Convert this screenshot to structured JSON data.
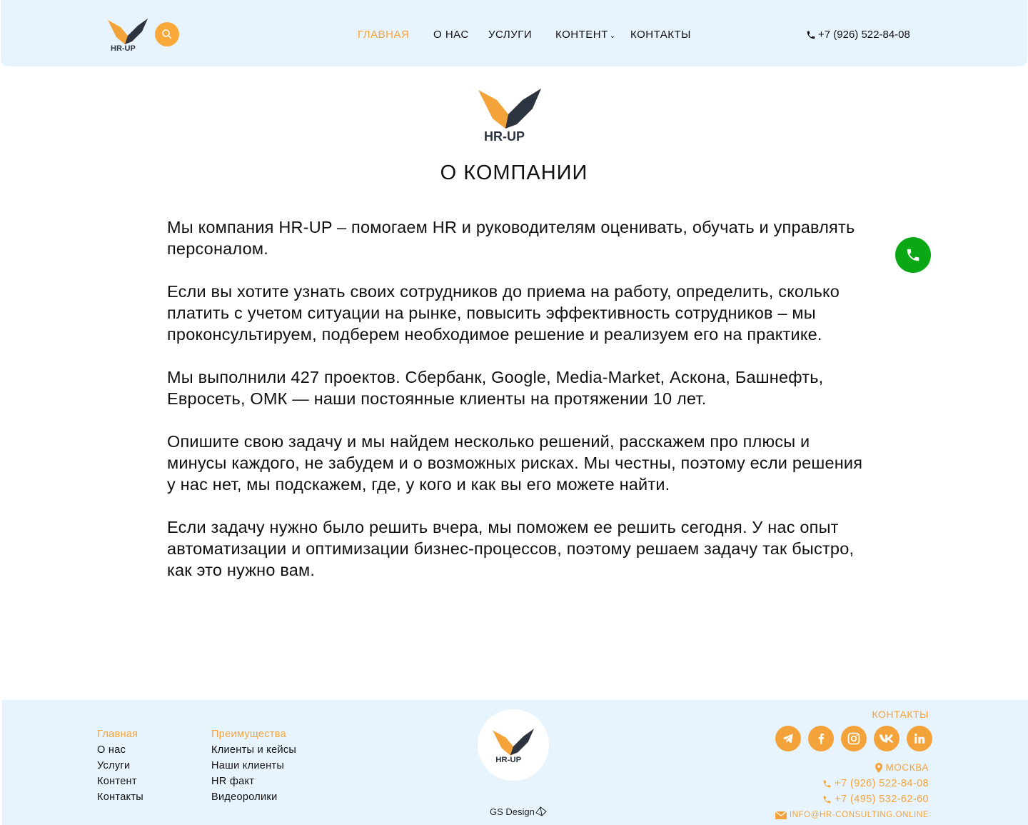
{
  "header": {
    "logo_text": "HR-UP",
    "nav": [
      {
        "label": "ГЛАВНАЯ",
        "active": true
      },
      {
        "label": "О НАС"
      },
      {
        "label": "УСЛУГИ"
      },
      {
        "label": "КОНТЕНТ"
      },
      {
        "label": "КОНТАКТЫ"
      }
    ],
    "phone": "+7 (926) 522-84-08"
  },
  "main": {
    "logo_text": "HR-UP",
    "title": "О КОМПАНИИ",
    "paragraphs": [
      "Мы компания HR-UP – помогаем HR и руководителям оценивать, обучать и управлять персоналом.",
      "Если вы хотите узнать своих сотрудников до приема на работу, определить, сколько платить с учетом ситуации на рынке, повысить эффективность сотрудников – мы проконсультируем, подберем необходимое решение и реализуем его на практике.",
      "Мы выполнили 427 проектов. Сбербанк, Google, Media-Market, Аскона, Башнефть, Евросеть, ОМК — наши постоянные клиенты на протяжении 10 лет.",
      "Опишите свою задачу и мы найдем несколько решений, расскажем про плюсы и минусы каждого, не забудем и о возможных рисках. Мы честны, поэтому если решения у нас нет, мы подскажем, где, у кого и как вы его можете найти.",
      "Если задачу нужно было решить вчера, мы поможем ее решить сегодня. У нас опыт автоматизации и оптимизации бизнес-процессов, поэтому решаем задачу так быстро, как это нужно вам."
    ]
  },
  "footer": {
    "col1": [
      "Главная",
      "О нас",
      "Услуги",
      "Контент",
      "Контакты"
    ],
    "col2": [
      "Преимущества",
      "Клиенты и кейсы",
      "Наши клиенты",
      "HR факт",
      "Видеоролики"
    ],
    "logo_text": "HR-UP",
    "credit": "GS Design",
    "contacts_title": "КОНТАКТЫ",
    "socials": [
      "telegram-icon",
      "facebook-icon",
      "instagram-icon",
      "vk-icon",
      "linkedin-icon"
    ],
    "city": "МОСКВА",
    "phone1": "+7 (926) 522-84-08",
    "phone2": "+7 (495) 532-62-60",
    "email": "INFO@HR-CONSULTING.ONLINE"
  },
  "colors": {
    "accent": "#f4a33a",
    "header_bg": "#e8f4fd",
    "call_button": "#0aa815",
    "text": "#111111"
  }
}
